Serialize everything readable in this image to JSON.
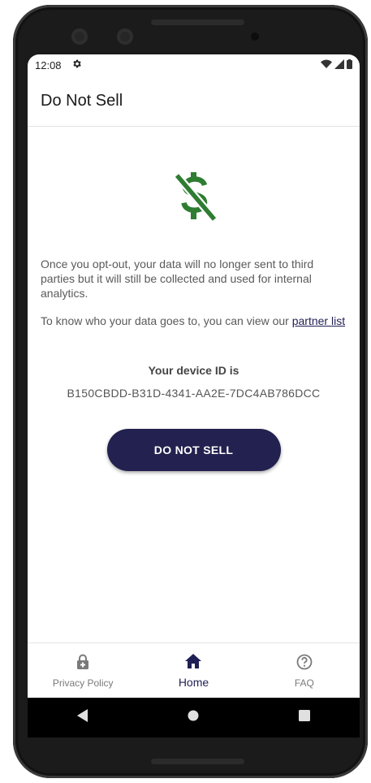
{
  "status": {
    "time": "12:08"
  },
  "appbar": {
    "title": "Do Not Sell"
  },
  "main": {
    "paragraph1": "Once you opt-out, your data will no longer sent to third parties but it will still be collected and used for internal analytics.",
    "paragraph2_prefix": "To know who your data goes to, you can view our ",
    "partner_link": "partner list",
    "device_id_label": "Your device ID is",
    "device_id": "B150CBDD-B31D-4341-AA2E-7DC4AB786DCC",
    "button": "DO NOT SELL"
  },
  "nav": {
    "items": [
      {
        "label": "Privacy Policy",
        "icon": "lock-icon"
      },
      {
        "label": "Home",
        "icon": "home-icon"
      },
      {
        "label": "FAQ",
        "icon": "help-circle-icon"
      }
    ],
    "active": "Home"
  },
  "system_nav": {
    "icons": [
      "back-icon",
      "home-circle-icon",
      "recents-icon"
    ]
  },
  "colors": {
    "accent": "#22214F",
    "money_icon": "#2E7D32"
  }
}
